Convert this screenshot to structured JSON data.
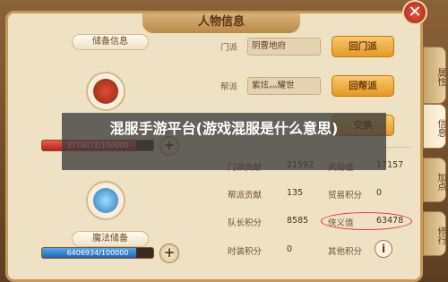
{
  "window": {
    "title": "人物信息",
    "close_label": "✕"
  },
  "left": {
    "reserve_label": "储备信息",
    "hp_bar": {
      "text": "3774072/100000",
      "fill_fraction": 0.85
    },
    "magic_label": "魔法储备",
    "mp_bar": {
      "text": "6406934/100000",
      "fill_fraction": 0.85
    },
    "plus_label": "+"
  },
  "right": {
    "sect": {
      "label": "门派",
      "value": "阴曹地府",
      "button": "回门派"
    },
    "guild": {
      "label": "帮派",
      "value": "紫炫灬耀世",
      "button": "回帮派"
    },
    "hidden_button": "交换",
    "stats": [
      {
        "label": "门派贡献",
        "value": "21592"
      },
      {
        "label": "武勋值",
        "value": "17157"
      },
      {
        "label": "帮派贡献",
        "value": "135"
      },
      {
        "label": "贸易积分",
        "value": "0"
      },
      {
        "label": "队长积分",
        "value": "8585"
      },
      {
        "label": "侠义值",
        "value": "63478"
      },
      {
        "label": "时装积分",
        "value": "0"
      },
      {
        "label": "其他积分",
        "value": ""
      }
    ],
    "info_icon_label": "i"
  },
  "side_tabs": [
    "属性",
    "信息",
    "加点",
    "修行"
  ],
  "overlay_text": "混服手游平台(游戏混服是什么意思)",
  "colors": {
    "hp_fill": "#d9362c",
    "mp_fill": "#2f7fd6",
    "highlight": "#d8343a"
  }
}
